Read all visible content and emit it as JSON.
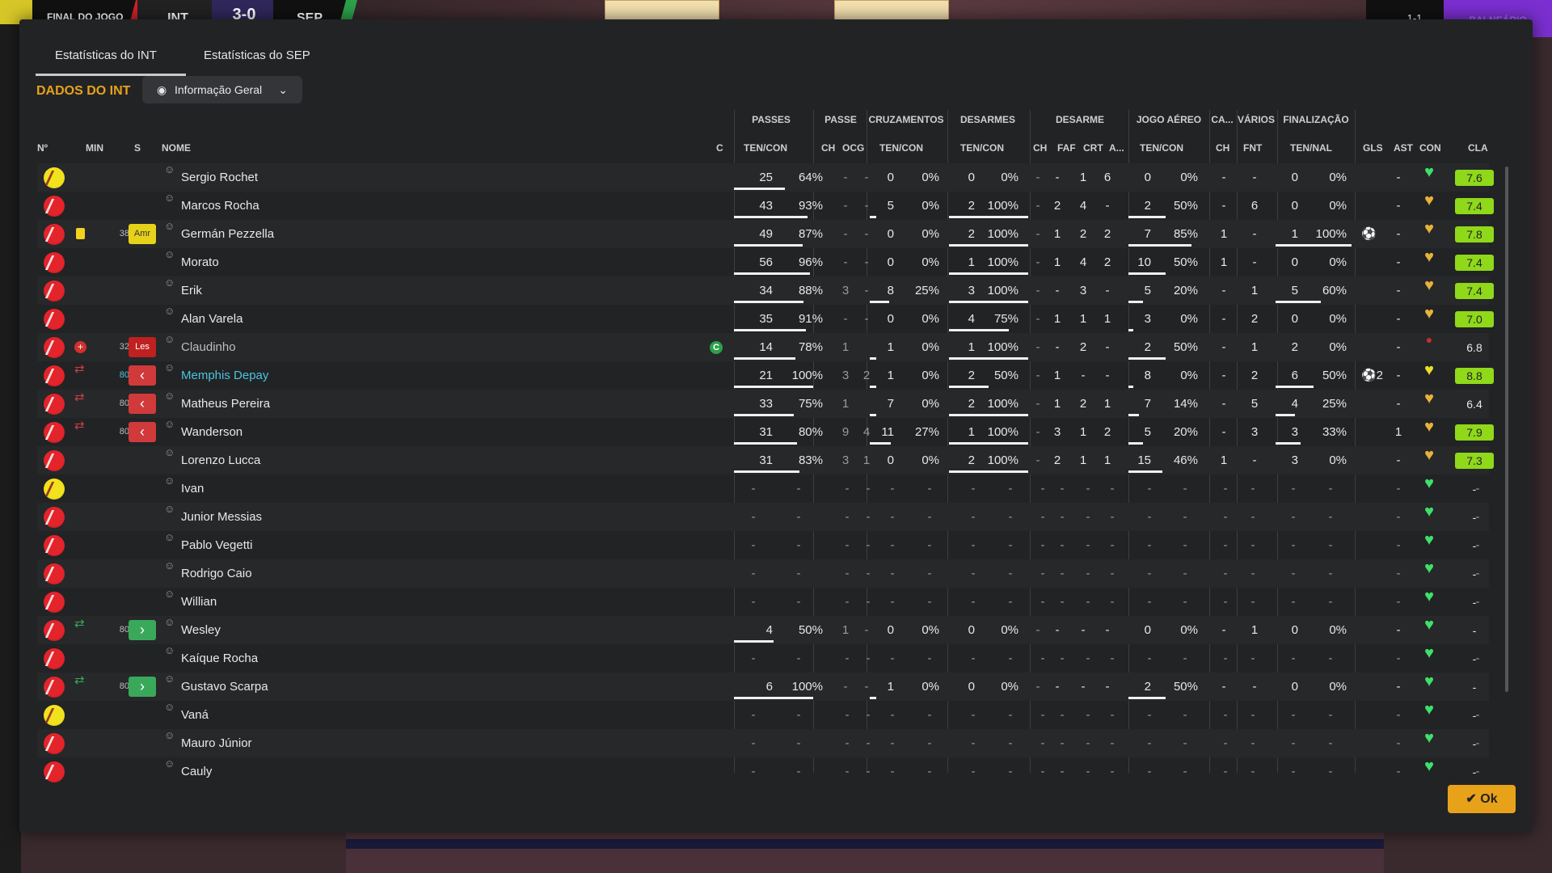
{
  "topbar": {
    "status": "FINAL DO JOGO",
    "home": "INT",
    "score": "3-0",
    "away": "SEP",
    "right_score": "1-1",
    "right_label": "BALNEÁRIO"
  },
  "tabs": [
    {
      "label": "Estatísticas do INT"
    },
    {
      "label": "Estatísticas do SEP"
    }
  ],
  "section_title": "DADOS DO INT",
  "view_select": "Informação Geral",
  "groups": [
    "PASSES",
    "PASSE",
    "CRUZAMENTOS",
    "DESARMES",
    "DESARME",
    "JOGO AÉREO",
    "CA...",
    "VÁRIOS",
    "FINALIZAÇÃO"
  ],
  "columns": {
    "num": "Nº",
    "min": "MIN",
    "s": "S",
    "name": "NOME",
    "c": "C",
    "passes": "TEN/CON",
    "passe_ch": "CH",
    "passe_ocg": "OCG",
    "cruz": "TEN/CON",
    "desarmes": "TEN/CON",
    "d_ch": "CH",
    "d_faf": "FAF",
    "d_crt": "CRT",
    "d_a": "A...",
    "aereo": "TEN/CON",
    "ca_ch": "CH",
    "varios_fnt": "FNT",
    "fin": "TEN/NAL",
    "gls": "GLS",
    "ast": "AST",
    "con": "CON",
    "cla": "CLA"
  },
  "players": [
    {
      "shirt": "yel",
      "name": "Sergio Rochet",
      "pa": "25",
      "pp": "64%",
      "bar": 0.64,
      "pch": "-",
      "ocg": "-",
      "ca": "0",
      "cp": "0%",
      "da": "0",
      "dp": "0%",
      "dch": "-",
      "faf": "-",
      "crt": "1",
      "a": "6",
      "aa": "0",
      "ap": "0%",
      "cach": "-",
      "fnt": "-",
      "fa": "0",
      "fp": "0%",
      "gls": "",
      "ast": "-",
      "heart": "g",
      "cla": "7.6",
      "hi": true
    },
    {
      "shirt": "red",
      "name": "Marcos Rocha",
      "pa": "43",
      "pp": "93%",
      "bar": 0.93,
      "pch": "-",
      "ocg": "-",
      "ca": "5",
      "cp": "0%",
      "da": "2",
      "dp": "100%",
      "dch": "-",
      "faf": "2",
      "crt": "4",
      "a": "-",
      "aa": "2",
      "ap": "50%",
      "cach": "-",
      "fnt": "6",
      "fa": "0",
      "fp": "0%",
      "gls": "",
      "ast": "-",
      "heart": "o",
      "cla": "7.4",
      "hi": true
    },
    {
      "shirt": "red",
      "card": "yellow",
      "min": "38",
      "badge": "amr",
      "badge_text": "Amr",
      "name": "Germán Pezzella",
      "pa": "49",
      "pp": "87%",
      "bar": 0.87,
      "pch": "-",
      "ocg": "-",
      "ca": "0",
      "cp": "0%",
      "da": "2",
      "dp": "100%",
      "dch": "-",
      "faf": "1",
      "crt": "2",
      "a": "2",
      "aa": "7",
      "ap": "85%",
      "cach": "1",
      "fnt": "-",
      "fa": "1",
      "fp": "100%",
      "gls": "⚽",
      "ast": "-",
      "heart": "o",
      "cla": "7.8",
      "hi": true
    },
    {
      "shirt": "red",
      "name": "Morato",
      "pa": "56",
      "pp": "96%",
      "bar": 0.96,
      "pch": "-",
      "ocg": "-",
      "ca": "0",
      "cp": "0%",
      "da": "1",
      "dp": "100%",
      "dch": "-",
      "faf": "1",
      "crt": "4",
      "a": "2",
      "aa": "10",
      "ap": "50%",
      "cach": "1",
      "fnt": "-",
      "fa": "0",
      "fp": "0%",
      "gls": "",
      "ast": "-",
      "heart": "o",
      "cla": "7.4",
      "hi": true
    },
    {
      "shirt": "red",
      "name": "Erik",
      "pa": "34",
      "pp": "88%",
      "bar": 0.88,
      "pch": "3",
      "ocg": "-",
      "ca": "8",
      "cp": "25%",
      "da": "3",
      "dp": "100%",
      "dch": "-",
      "faf": "-",
      "crt": "3",
      "a": "-",
      "aa": "5",
      "ap": "20%",
      "cach": "-",
      "fnt": "1",
      "fa": "5",
      "fp": "60%",
      "gls": "",
      "ast": "-",
      "heart": "o",
      "cla": "7.4",
      "hi": true
    },
    {
      "shirt": "red",
      "name": "Alan Varela",
      "pa": "35",
      "pp": "91%",
      "bar": 0.91,
      "pch": "-",
      "ocg": "-",
      "ca": "0",
      "cp": "0%",
      "da": "4",
      "dp": "75%",
      "dch": "-",
      "faf": "1",
      "crt": "1",
      "a": "1",
      "aa": "3",
      "ap": "0%",
      "cach": "-",
      "fnt": "2",
      "fa": "0",
      "fp": "0%",
      "gls": "",
      "ast": "-",
      "heart": "o",
      "cla": "7.0",
      "hi": true
    },
    {
      "shirt": "red",
      "injury": true,
      "min": "32",
      "badge": "les",
      "badge_text": "Les",
      "name": "Claudinho",
      "dimname": true,
      "captain": "C",
      "pa": "14",
      "pp": "78%",
      "bar": 0.78,
      "pch": "1",
      "ocg": "",
      "ca": "1",
      "cp": "0%",
      "da": "1",
      "dp": "100%",
      "dch": "-",
      "faf": "-",
      "crt": "2",
      "a": "-",
      "aa": "2",
      "ap": "50%",
      "cach": "-",
      "fnt": "1",
      "fa": "2",
      "fp": "0%",
      "gls": "",
      "ast": "-",
      "heart": "rd",
      "cla": "6.8",
      "hi": false
    },
    {
      "shirt": "red",
      "sub": "out",
      "min": "80",
      "badge": "out",
      "badge_text": "‹",
      "name": "Memphis Depay",
      "teal": true,
      "pa": "21",
      "pp": "100%",
      "bar": 1,
      "pch": "3",
      "ocg": "2",
      "ca": "1",
      "cp": "0%",
      "da": "2",
      "dp": "50%",
      "dch": "-",
      "faf": "1",
      "crt": "-",
      "a": "-",
      "aa": "8",
      "ap": "0%",
      "cach": "-",
      "fnt": "2",
      "fa": "6",
      "fp": "50%",
      "gls": "⚽2",
      "ast": "-",
      "heart": "y",
      "cla": "8.8",
      "hi": true
    },
    {
      "shirt": "red",
      "sub": "out",
      "min": "80",
      "badge": "out",
      "badge_text": "‹",
      "name": "Matheus Pereira",
      "pa": "33",
      "pp": "75%",
      "bar": 0.75,
      "pch": "1",
      "ocg": "",
      "ca": "7",
      "cp": "0%",
      "da": "2",
      "dp": "100%",
      "dch": "-",
      "faf": "1",
      "crt": "2",
      "a": "1",
      "aa": "7",
      "ap": "14%",
      "cach": "-",
      "fnt": "5",
      "fa": "4",
      "fp": "25%",
      "gls": "",
      "ast": "-",
      "heart": "o",
      "cla": "6.4",
      "hi": false
    },
    {
      "shirt": "red",
      "sub": "out",
      "min": "80",
      "badge": "out",
      "badge_text": "‹",
      "name": "Wanderson",
      "pa": "31",
      "pp": "80%",
      "bar": 0.8,
      "pch": "9",
      "ocg": "4",
      "ca": "11",
      "cp": "27%",
      "da": "1",
      "dp": "100%",
      "dch": "-",
      "faf": "3",
      "crt": "1",
      "a": "2",
      "aa": "5",
      "ap": "20%",
      "cach": "-",
      "fnt": "3",
      "fa": "3",
      "fp": "33%",
      "gls": "",
      "ast": "1",
      "heart": "o",
      "cla": "7.9",
      "hi": true
    },
    {
      "shirt": "red",
      "name": "Lorenzo Lucca",
      "pa": "31",
      "pp": "83%",
      "bar": 0.83,
      "pch": "3",
      "ocg": "1",
      "ca": "0",
      "cp": "0%",
      "da": "2",
      "dp": "100%",
      "dch": "-",
      "faf": "2",
      "crt": "1",
      "a": "1",
      "aa": "15",
      "ap": "46%",
      "cach": "1",
      "fnt": "-",
      "fa": "3",
      "fp": "0%",
      "gls": "",
      "ast": "-",
      "heart": "o",
      "cla": "7.3",
      "hi": true
    },
    {
      "shirt": "yel",
      "name": "Ivan",
      "bench": true
    },
    {
      "shirt": "red",
      "name": "Junior Messias",
      "bench": true
    },
    {
      "shirt": "red",
      "name": "Pablo Vegetti",
      "bench": true
    },
    {
      "shirt": "red",
      "name": "Rodrigo Caio",
      "bench": true
    },
    {
      "shirt": "red",
      "name": "Willian",
      "bench": true
    },
    {
      "shirt": "red",
      "sub": "in",
      "min": "80",
      "badge": "in",
      "badge_text": "›",
      "name": "Wesley",
      "pa": "4",
      "pp": "50%",
      "bar": 0.5,
      "pch": "1",
      "ocg": "-",
      "ca": "0",
      "cp": "0%",
      "da": "0",
      "dp": "0%",
      "dch": "-",
      "faf": "-",
      "crt": "-",
      "a": "-",
      "aa": "0",
      "ap": "0%",
      "cach": "-",
      "fnt": "1",
      "fa": "0",
      "fp": "0%",
      "gls": "",
      "ast": "-",
      "heart": "g",
      "cla": "-",
      "hi": false
    },
    {
      "shirt": "red",
      "name": "Kaíque Rocha",
      "bench": true
    },
    {
      "shirt": "red",
      "sub": "in",
      "min": "80",
      "badge": "in",
      "badge_text": "›",
      "name": "Gustavo Scarpa",
      "pa": "6",
      "pp": "100%",
      "bar": 1,
      "pch": "-",
      "ocg": "-",
      "ca": "1",
      "cp": "0%",
      "da": "0",
      "dp": "0%",
      "dch": "-",
      "faf": "-",
      "crt": "-",
      "a": "-",
      "aa": "2",
      "ap": "50%",
      "cach": "-",
      "fnt": "-",
      "fa": "0",
      "fp": "0%",
      "gls": "",
      "ast": "-",
      "heart": "g",
      "cla": "-",
      "hi": false
    },
    {
      "shirt": "yel",
      "name": "Vaná",
      "bench": true
    },
    {
      "shirt": "red",
      "name": "Mauro Júnior",
      "bench": true
    },
    {
      "shirt": "red",
      "name": "Cauly",
      "bench": true
    }
  ],
  "ok_label": "Ok"
}
